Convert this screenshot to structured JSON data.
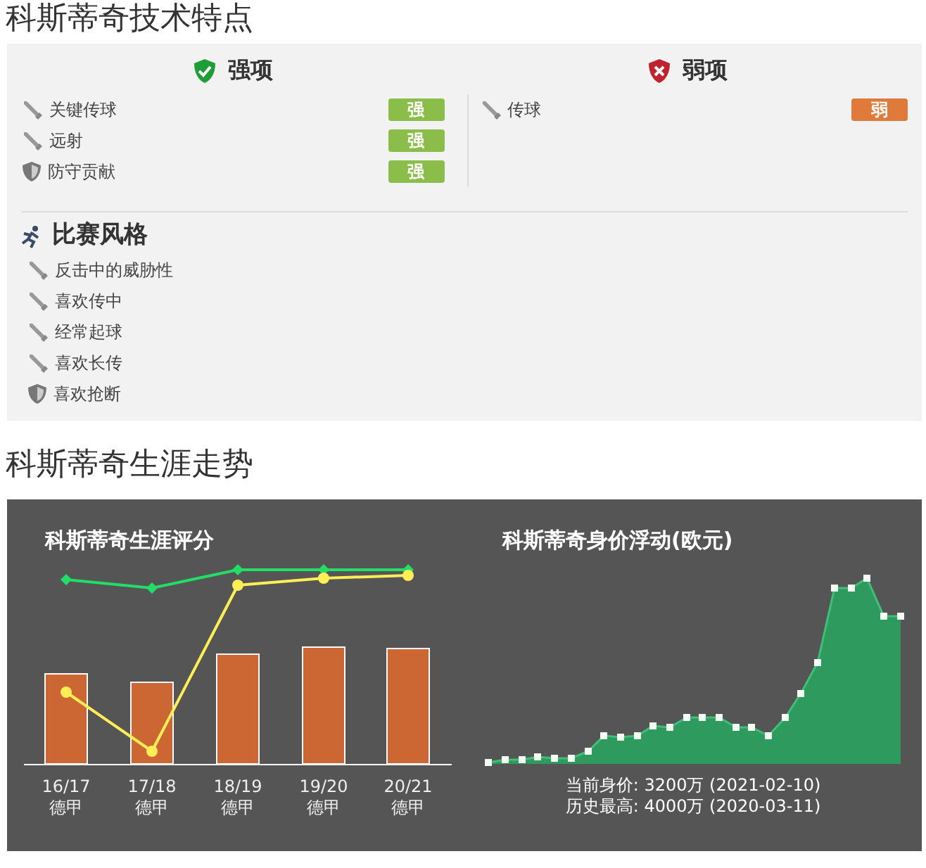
{
  "tech_title": "科斯蒂奇技术特点",
  "strengths": {
    "title": "强项",
    "items": [
      {
        "label": "关键传球",
        "kind": "sword",
        "badge": "强"
      },
      {
        "label": "远射",
        "kind": "sword",
        "badge": "强"
      },
      {
        "label": "防守贡献",
        "kind": "shield",
        "badge": "强"
      }
    ]
  },
  "weaknesses": {
    "title": "弱项",
    "items": [
      {
        "label": "传球",
        "kind": "sword",
        "badge": "弱"
      }
    ]
  },
  "style": {
    "title": "比赛风格",
    "items": [
      {
        "label": "反击中的威胁性",
        "kind": "sword"
      },
      {
        "label": "喜欢传中",
        "kind": "sword"
      },
      {
        "label": "经常起球",
        "kind": "sword"
      },
      {
        "label": "喜欢长传",
        "kind": "sword"
      },
      {
        "label": "喜欢抢断",
        "kind": "shield"
      }
    ]
  },
  "career_title": "科斯蒂奇生涯走势",
  "rating_chart": {
    "title": "科斯蒂奇生涯评分",
    "seasons": [
      {
        "season": "16/17",
        "league": "德甲"
      },
      {
        "season": "17/18",
        "league": "德甲"
      },
      {
        "season": "18/19",
        "league": "德甲"
      },
      {
        "season": "19/20",
        "league": "德甲"
      },
      {
        "season": "20/21",
        "league": "德甲"
      }
    ]
  },
  "value_chart": {
    "title": "科斯蒂奇身价浮动(欧元)",
    "current": "当前身价: 3200万 (2021-02-10)",
    "peak": "历史最高: 4000万 (2020-03-11)"
  }
}
